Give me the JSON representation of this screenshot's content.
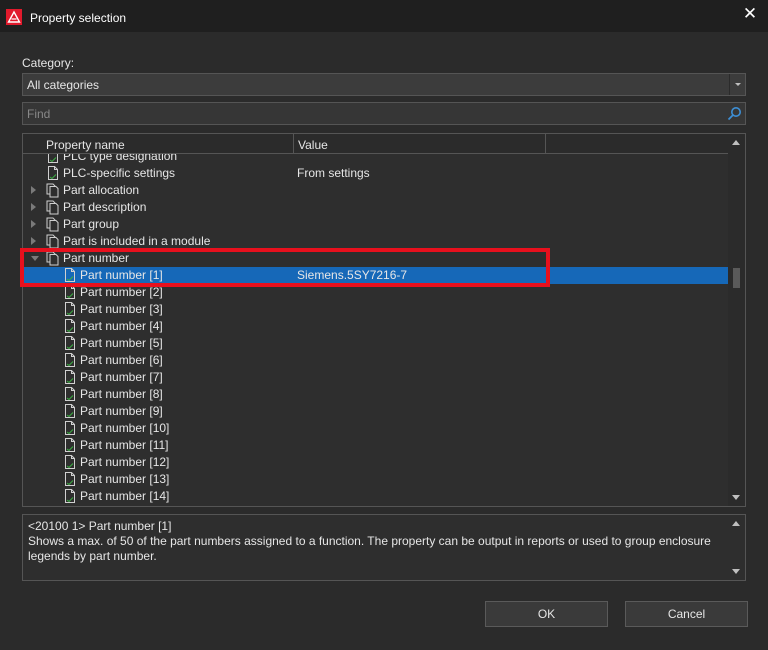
{
  "window": {
    "title": "Property selection",
    "close_glyph": "✕"
  },
  "category": {
    "label": "Category:",
    "selected": "All categories"
  },
  "find": {
    "placeholder": "Find"
  },
  "tree": {
    "columns": [
      "Property name",
      "Value"
    ],
    "rows": [
      {
        "name": "PLC type designation",
        "value": "",
        "level": 1,
        "type": "leaf",
        "expander": "none",
        "selected": false
      },
      {
        "name": "PLC-specific settings",
        "value": "From settings",
        "level": 1,
        "type": "leaf",
        "expander": "none",
        "selected": false
      },
      {
        "name": "Part allocation",
        "value": "",
        "level": 1,
        "type": "group",
        "expander": "closed",
        "selected": false
      },
      {
        "name": "Part description",
        "value": "",
        "level": 1,
        "type": "group",
        "expander": "closed",
        "selected": false
      },
      {
        "name": "Part group",
        "value": "",
        "level": 1,
        "type": "group",
        "expander": "closed",
        "selected": false
      },
      {
        "name": "Part is included in a module",
        "value": "",
        "level": 1,
        "type": "group",
        "expander": "closed",
        "selected": false
      },
      {
        "name": "Part number",
        "value": "",
        "level": 1,
        "type": "group",
        "expander": "open",
        "selected": false
      },
      {
        "name": "Part number [1]",
        "value": "Siemens.5SY7216-7",
        "level": 2,
        "type": "leaf",
        "expander": "none",
        "selected": true
      },
      {
        "name": "Part number [2]",
        "value": "",
        "level": 2,
        "type": "leaf",
        "expander": "none",
        "selected": false
      },
      {
        "name": "Part number [3]",
        "value": "",
        "level": 2,
        "type": "leaf",
        "expander": "none",
        "selected": false
      },
      {
        "name": "Part number [4]",
        "value": "",
        "level": 2,
        "type": "leaf",
        "expander": "none",
        "selected": false
      },
      {
        "name": "Part number [5]",
        "value": "",
        "level": 2,
        "type": "leaf",
        "expander": "none",
        "selected": false
      },
      {
        "name": "Part number [6]",
        "value": "",
        "level": 2,
        "type": "leaf",
        "expander": "none",
        "selected": false
      },
      {
        "name": "Part number [7]",
        "value": "",
        "level": 2,
        "type": "leaf",
        "expander": "none",
        "selected": false
      },
      {
        "name": "Part number [8]",
        "value": "",
        "level": 2,
        "type": "leaf",
        "expander": "none",
        "selected": false
      },
      {
        "name": "Part number [9]",
        "value": "",
        "level": 2,
        "type": "leaf",
        "expander": "none",
        "selected": false
      },
      {
        "name": "Part number [10]",
        "value": "",
        "level": 2,
        "type": "leaf",
        "expander": "none",
        "selected": false
      },
      {
        "name": "Part number [11]",
        "value": "",
        "level": 2,
        "type": "leaf",
        "expander": "none",
        "selected": false
      },
      {
        "name": "Part number [12]",
        "value": "",
        "level": 2,
        "type": "leaf",
        "expander": "none",
        "selected": false
      },
      {
        "name": "Part number [13]",
        "value": "",
        "level": 2,
        "type": "leaf",
        "expander": "none",
        "selected": false
      },
      {
        "name": "Part number [14]",
        "value": "",
        "level": 2,
        "type": "leaf",
        "expander": "none",
        "selected": false
      }
    ]
  },
  "description": {
    "line1": "<20100 1> Part number [1]",
    "line2": "Shows a max. of 50 of the part numbers assigned to a function. The property can be output in reports or used to group enclosure legends by part number."
  },
  "buttons": {
    "ok": "OK",
    "cancel": "Cancel"
  },
  "colors": {
    "selection": "#1668b8",
    "highlight_box": "#e8101d",
    "accent_icon": "#e11a2c"
  }
}
